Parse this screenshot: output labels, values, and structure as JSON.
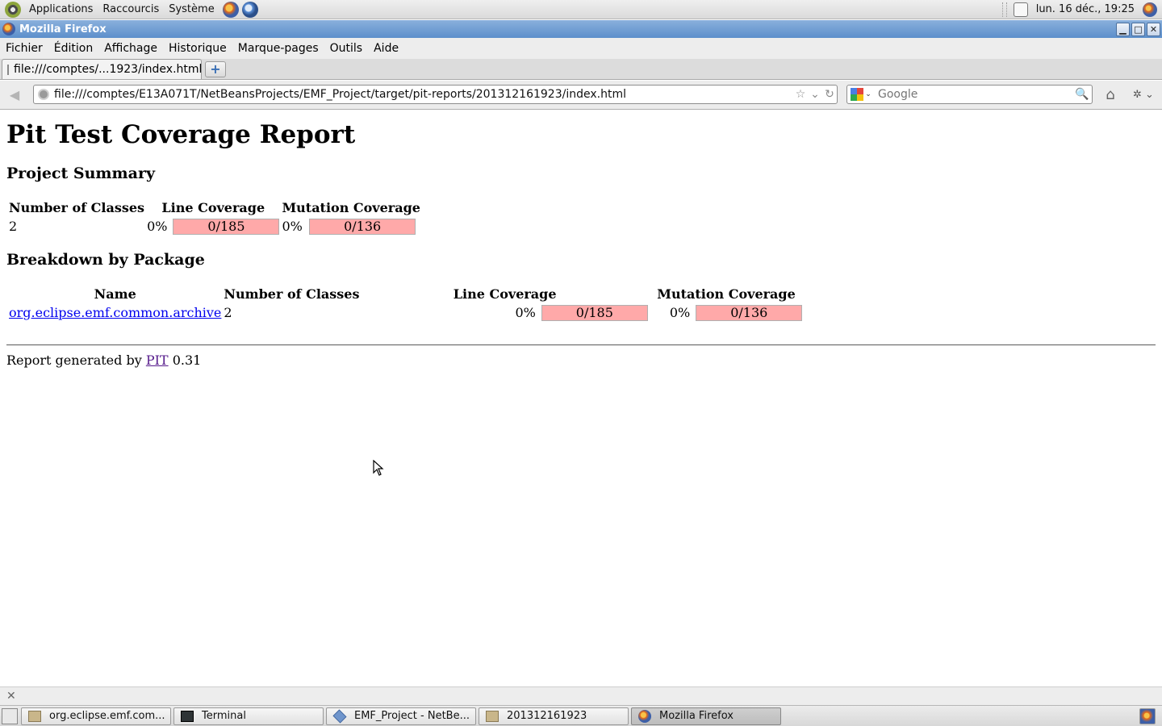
{
  "panel": {
    "menus": [
      "Applications",
      "Raccourcis",
      "Système"
    ],
    "clock": "lun. 16 déc., 19:25"
  },
  "window": {
    "title": "Mozilla Firefox",
    "buttons": [
      "▁",
      "□",
      "✕"
    ]
  },
  "menubar": {
    "items": [
      "Fichier",
      "Édition",
      "Affichage",
      "Historique",
      "Marque-pages",
      "Outils",
      "Aide"
    ]
  },
  "tabs": [
    {
      "label": "file:///comptes/...1923/index.html",
      "active": true
    }
  ],
  "newtab_label": "+",
  "navbar": {
    "back": "◀",
    "url": "file:///comptes/E13A071T/NetBeansProjects/EMF_Project/target/pit-reports/201312161923/index.html",
    "bookmark_star": "☆",
    "history_drop": "⌄",
    "reload": "↻",
    "search_placeholder": "Google",
    "search_engine_drop": "⌄",
    "search_go": "🔍",
    "home": "⌂",
    "tools": "✲ ⌄"
  },
  "report": {
    "title": "Pit Test Coverage Report",
    "summary_heading": "Project Summary",
    "summary_headers": [
      "Number of Classes",
      "Line Coverage",
      "Mutation Coverage"
    ],
    "summary": {
      "classes": "2",
      "line_pct": "0%",
      "line_bar": "0/185",
      "mutation_pct": "0%",
      "mutation_bar": "0/136"
    },
    "breakdown_heading": "Breakdown by Package",
    "breakdown_headers": [
      "Name",
      "Number of Classes",
      "Line Coverage",
      "Mutation Coverage"
    ],
    "packages": [
      {
        "name": "org.eclipse.emf.common.archive",
        "classes": "2",
        "line_pct": "0%",
        "line_bar": "0/185",
        "mutation_pct": "0%",
        "mutation_bar": "0/136"
      }
    ],
    "footer_prefix": "Report generated by",
    "footer_link": "PIT",
    "footer_version": "0.31"
  },
  "findbar_close": "✕",
  "taskbar": {
    "tasks": [
      {
        "label": "org.eclipse.emf.com...",
        "icon": "folder-icon"
      },
      {
        "label": "Terminal",
        "icon": "terminal-icon"
      },
      {
        "label": "EMF_Project - NetBe...",
        "icon": "netbeans-icon"
      },
      {
        "label": "201312161923",
        "icon": "folder-icon"
      },
      {
        "label": "Mozilla Firefox",
        "icon": "firefox-icon",
        "active": true
      }
    ]
  },
  "colors": {
    "coverage_bar": "#ffa9a9",
    "titlebar": "#5c8fcb",
    "link": "#0000ee",
    "visited_link": "#551a8b"
  }
}
